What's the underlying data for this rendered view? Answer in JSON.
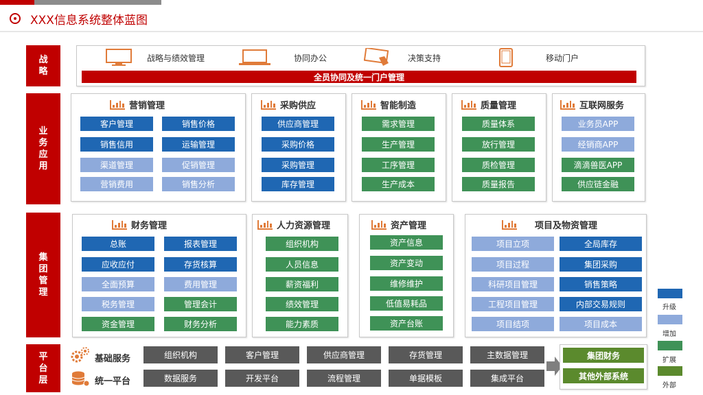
{
  "title": "XXX信息系统整体蓝图",
  "categories": {
    "strategy": "战略",
    "business": "业务应用",
    "group": "集团管理",
    "platform": "平台层"
  },
  "strategy": {
    "items": [
      "战略与绩效管理",
      "协同办公",
      "决策支持",
      "移动门户"
    ],
    "bar": "全员协同及统一门户管理"
  },
  "business": {
    "marketing": {
      "title": "营销管理",
      "items": [
        "客户管理",
        "销售价格",
        "销售信用",
        "运输管理",
        "渠道管理",
        "促销管理",
        "营销费用",
        "销售分析"
      ]
    },
    "procurement": {
      "title": "采购供应",
      "items": [
        "供应商管理",
        "采购价格",
        "采购管理",
        "库存管理"
      ]
    },
    "manufacturing": {
      "title": "智能制造",
      "items": [
        "需求管理",
        "生产管理",
        "工序管理",
        "生产成本"
      ]
    },
    "quality": {
      "title": "质量管理",
      "items": [
        "质量体系",
        "放行管理",
        "质检管理",
        "质量报告"
      ]
    },
    "internet": {
      "title": "互联网服务",
      "items": [
        "业务员APP",
        "经销商APP",
        "滴滴兽医APP",
        "供应链金融"
      ]
    }
  },
  "group": {
    "finance": {
      "title": "财务管理",
      "items": [
        "总账",
        "报表管理",
        "应收应付",
        "存货核算",
        "全面预算",
        "费用管理",
        "税务管理",
        "管理会计",
        "资金管理",
        "财务分析"
      ]
    },
    "hr": {
      "title": "人力资源管理",
      "items": [
        "组织机构",
        "人员信息",
        "薪资福利",
        "绩效管理",
        "能力素质"
      ]
    },
    "assets": {
      "title": "资产管理",
      "items": [
        "资产信息",
        "资产变动",
        "维修维护",
        "低值易耗品",
        "资产台账"
      ]
    },
    "projects": {
      "title": "项目及物资管理",
      "items": [
        "项目立项",
        "全局库存",
        "项目过程",
        "集团采购",
        "科研项目管理",
        "销售策略",
        "工程项目管理",
        "内部交易规则",
        "项目结项",
        "项目成本"
      ]
    }
  },
  "platform": {
    "labels": [
      "基础服务",
      "统一平台"
    ],
    "row1": [
      "组织机构",
      "客户管理",
      "供应商管理",
      "存货管理",
      "主数据管理"
    ],
    "row2": [
      "数据服务",
      "开发平台",
      "流程管理",
      "单据模板",
      "集成平台"
    ],
    "external": [
      "集团财务",
      "其他外部系统"
    ]
  },
  "legend": [
    "升级",
    "增加",
    "扩展",
    "外部"
  ],
  "colors": {
    "upgrade": "#1f67b3",
    "add": "#8eaadb",
    "expand": "#3f9257",
    "external": "#5b8a2d",
    "category": "#c00000"
  }
}
